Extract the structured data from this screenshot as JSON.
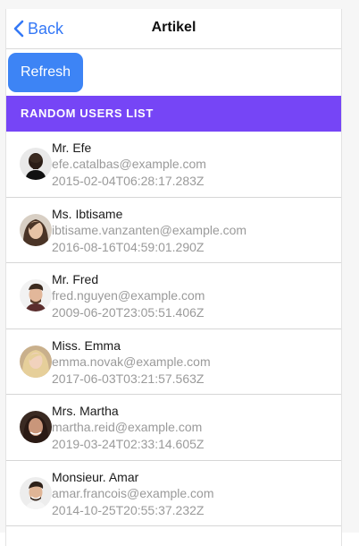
{
  "nav": {
    "back_label": "Back",
    "title": "Artikel"
  },
  "toolbar": {
    "refresh_label": "Refresh"
  },
  "section": {
    "header": "RANDOM USERS LIST"
  },
  "users": [
    {
      "name": "Mr. Efe",
      "email": "efe.catalbas@example.com",
      "date": "2015-02-04T06:28:17.283Z"
    },
    {
      "name": "Ms. Ibtisame",
      "email": "ibtisame.vanzanten@example.com",
      "date": "2016-08-16T04:59:01.290Z"
    },
    {
      "name": "Mr. Fred",
      "email": "fred.nguyen@example.com",
      "date": "2009-06-20T23:05:51.406Z"
    },
    {
      "name": "Miss. Emma",
      "email": "emma.novak@example.com",
      "date": "2017-06-03T03:21:57.563Z"
    },
    {
      "name": "Mrs. Martha",
      "email": "martha.reid@example.com",
      "date": "2019-03-24T02:33:14.605Z"
    },
    {
      "name": "Monsieur. Amar",
      "email": "amar.francois@example.com",
      "date": "2014-10-25T20:55:37.232Z"
    }
  ],
  "colors": {
    "accent": "#3478f6",
    "button": "#3d84f5",
    "header_bar": "#7645f6",
    "secondary_text": "#9a9a9a"
  }
}
